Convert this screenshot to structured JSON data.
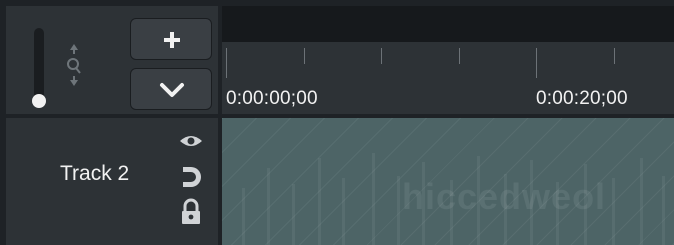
{
  "timeline": {
    "add_label": "+",
    "expand_icon": "chevron-down-icon",
    "time_start": "0:00:00;00",
    "time_20": "0:00:20;00"
  },
  "track": {
    "name": "Track 2",
    "clip_text": "hiccedweol"
  },
  "icons": [
    "zoom-slider-icon",
    "zoom-magnify-icon",
    "eye-icon",
    "magnet-icon",
    "lock-icon"
  ],
  "colors": {
    "panel": "#2d3236",
    "bg": "#1e2226",
    "clip": "#4d6466",
    "text": "#f2f2f2"
  }
}
